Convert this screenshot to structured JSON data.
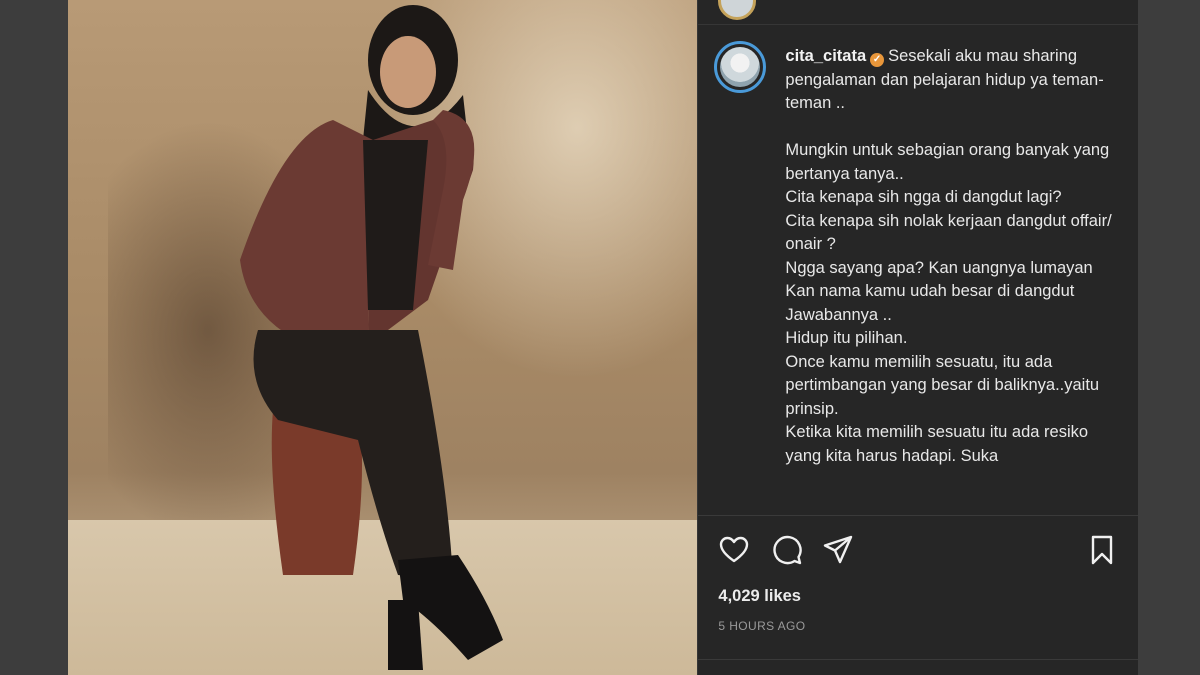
{
  "post": {
    "username": "cita_citata",
    "caption_lines_first": [
      "Sesekali aku mau sharing pengalaman dan pelajaran hidup ya teman-teman .."
    ],
    "caption_lines": [
      "Mungkin untuk sebagian orang banyak yang bertanya tanya..",
      "Cita kenapa sih ngga di dangdut lagi?",
      "Cita kenapa sih nolak kerjaan dangdut offair/ onair ?",
      "Ngga sayang apa? Kan uangnya lumayan",
      "Kan nama kamu udah besar di dangdut",
      "Jawabannya ..",
      "Hidup itu pilihan.",
      "Once kamu memilih sesuatu, itu ada pertimbangan yang besar di baliknya..yaitu prinsip.",
      "Ketika kita memilih sesuatu itu ada resiko yang kita harus hadapi. Suka"
    ],
    "likes": "4,029 likes",
    "time": "5 HOURS AGO"
  },
  "icons": {
    "like": "heart-icon",
    "comment": "comment-icon",
    "share": "send-icon",
    "save": "bookmark-icon",
    "verified": "verified-badge-icon"
  },
  "colors": {
    "verified": "#e8963a",
    "story_ring": "#4a9ad9"
  }
}
